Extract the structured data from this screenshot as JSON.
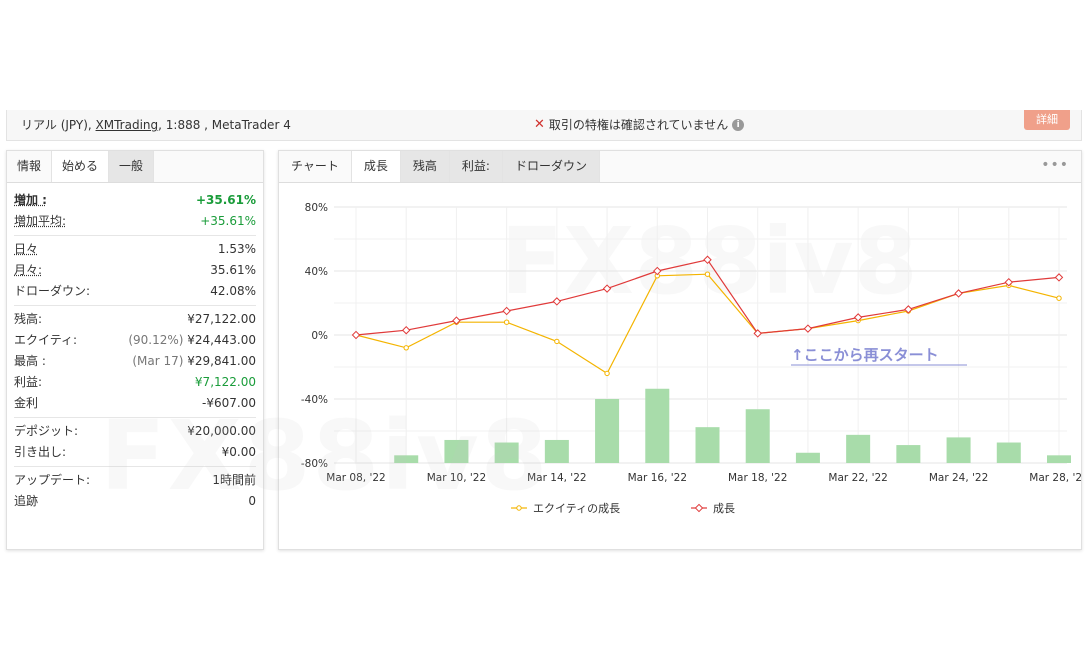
{
  "header": {
    "account_prefix": "リアル (JPY), ",
    "broker_link": "XMTrading",
    "account_suffix": ", 1:888 , MetaTrader 4",
    "warning_text": "取引の特権は確認されていません",
    "details_button": "詳細"
  },
  "left_panel": {
    "tabs": [
      {
        "label": "情報"
      },
      {
        "label": "始める"
      },
      {
        "label": "一般"
      }
    ],
    "gain": {
      "label": "増加 :",
      "value": "+35.61%"
    },
    "avg_gain": {
      "label": "増加平均:",
      "value": "+35.61%"
    },
    "daily": {
      "label": "日々",
      "value": "1.53%"
    },
    "monthly": {
      "label": "月々:",
      "value": "35.61%"
    },
    "drawdown": {
      "label": "ドローダウン:",
      "value": "42.08%"
    },
    "balance": {
      "label": "残高:",
      "value": "¥27,122.00"
    },
    "equity": {
      "label": "エクイティ:",
      "note": "(90.12%)",
      "value": "¥24,443.00"
    },
    "highest": {
      "label": "最高 :",
      "note": "(Mar 17)",
      "value": "¥29,841.00"
    },
    "profit": {
      "label": "利益:",
      "value": "¥7,122.00"
    },
    "interest": {
      "label": "金利",
      "value": "-¥607.00"
    },
    "deposits": {
      "label": "デポジット:",
      "value": "¥20,000.00"
    },
    "withdrawals": {
      "label": "引き出し:",
      "value": "¥0.00"
    },
    "updated": {
      "label": "アップデート:",
      "value": "1時間前"
    },
    "tracking": {
      "label": "追跡",
      "value": "0"
    }
  },
  "right_panel": {
    "tabs": [
      {
        "label": "チャート"
      },
      {
        "label": "成長"
      },
      {
        "label": "残高"
      },
      {
        "label": "利益:"
      },
      {
        "label": "ドローダウン"
      }
    ],
    "more_icon": "more-dots-icon",
    "annotation": "↑ここから再スタート"
  },
  "chart_data": {
    "type": "line",
    "watermark": "FX88iv8",
    "y_ticks": [
      "80%",
      "40%",
      "0%",
      "-40%",
      "-80%"
    ],
    "ylim": [
      -80,
      80
    ],
    "x_tick_labels": [
      "Mar 08, '22",
      "Mar 10, '22",
      "Mar 14, '22",
      "Mar 16, '22",
      "Mar 18, '22",
      "Mar 22, '22",
      "Mar 24, '22",
      "Mar 28, '22"
    ],
    "x": [
      "Mar 08",
      "Mar 09",
      "Mar 10",
      "Mar 11",
      "Mar 14",
      "Mar 15",
      "Mar 16",
      "Mar 17",
      "Mar 18",
      "Mar 21",
      "Mar 22",
      "Mar 23",
      "Mar 24",
      "Mar 25",
      "Mar 28"
    ],
    "series": [
      {
        "name": "エクイティの成長",
        "color": "#f4b400",
        "values": [
          0,
          -8,
          8,
          8,
          -4,
          -24,
          37,
          38,
          1,
          4,
          9,
          15,
          26,
          31,
          23
        ]
      },
      {
        "name": "成長",
        "color": "#e03a3a",
        "values": [
          0,
          3,
          9,
          15,
          21,
          29,
          40,
          47,
          1,
          4,
          11,
          16,
          26,
          33,
          36
        ]
      }
    ],
    "bars": {
      "color": "#a8dcaa",
      "values": [
        0,
        3,
        9,
        8,
        9,
        25,
        29,
        14,
        21,
        4,
        11,
        7,
        10,
        8,
        3
      ]
    }
  }
}
